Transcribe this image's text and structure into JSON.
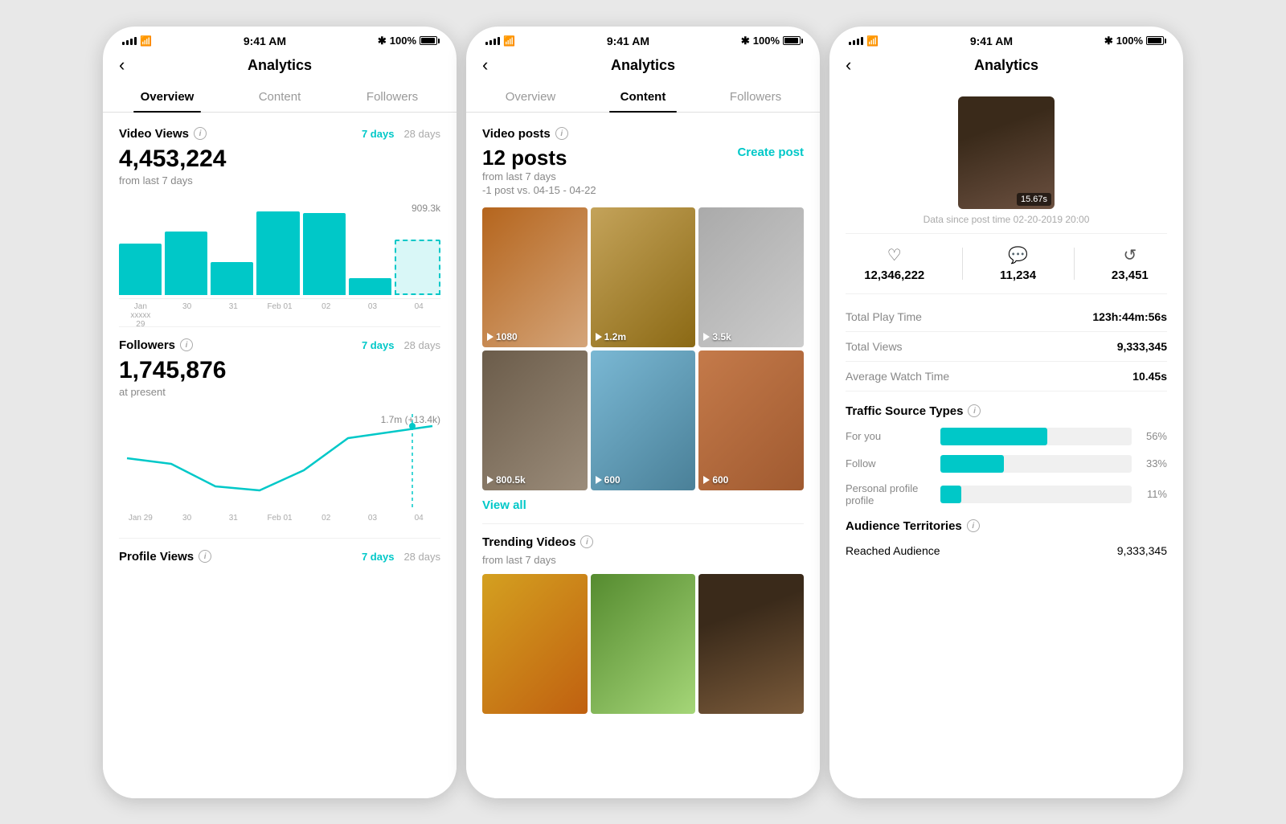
{
  "phones": [
    {
      "id": "overview",
      "statusBar": {
        "time": "9:41 AM",
        "battery": "100%"
      },
      "nav": {
        "back": "‹",
        "title": "Analytics"
      },
      "tabs": [
        {
          "label": "Overview",
          "active": true
        },
        {
          "label": "Content",
          "active": false
        },
        {
          "label": "Followers",
          "active": false
        }
      ],
      "videoViews": {
        "label": "Video Views",
        "period1": "7 days",
        "period2": "28 days",
        "value": "4,453,224",
        "sublabel": "from last 7 days",
        "chartTopLabel": "909.3k",
        "bars": [
          55,
          68,
          35,
          90,
          88,
          18,
          60
        ],
        "xLabels": [
          "Jan\nxxxxx\n29",
          "30",
          "31",
          "Feb 01",
          "02",
          "03",
          "04"
        ]
      },
      "followers": {
        "label": "Followers",
        "period1": "7 days",
        "period2": "28 days",
        "value": "1,745,876",
        "sublabel": "at present",
        "chartTopLabel": "1.7m (+13.4k)",
        "xLabels": [
          "Jan 29",
          "30",
          "31",
          "Feb 01",
          "02",
          "03",
          "04"
        ]
      },
      "profileViews": {
        "label": "Profile Views",
        "period1": "7 days",
        "period2": "28 days"
      }
    },
    {
      "id": "content",
      "statusBar": {
        "time": "9:41 AM",
        "battery": "100%"
      },
      "nav": {
        "back": "‹",
        "title": "Analytics"
      },
      "tabs": [
        {
          "label": "Overview",
          "active": false
        },
        {
          "label": "Content",
          "active": true
        },
        {
          "label": "Followers",
          "active": false
        }
      ],
      "videoPosts": {
        "label": "Video posts",
        "count": "12 posts",
        "sublabel": "from last 7 days",
        "change": "-1 post vs. 04-15 - 04-22",
        "createBtn": "Create post",
        "videos": [
          {
            "views": "1080",
            "color": "thumb-color-1"
          },
          {
            "views": "1.2m",
            "color": "thumb-color-2"
          },
          {
            "views": "3.5k",
            "color": "thumb-color-3"
          },
          {
            "views": "800.5k",
            "color": "thumb-color-4"
          },
          {
            "views": "600",
            "color": "thumb-color-5"
          },
          {
            "views": "600",
            "color": "thumb-color-6"
          }
        ],
        "viewAll": "View all"
      },
      "trendingVideos": {
        "label": "Trending Videos",
        "sublabel": "from last 7 days",
        "videos": [
          {
            "color": "thumb-food1"
          },
          {
            "color": "thumb-deer"
          },
          {
            "color": "thumb-arch"
          }
        ]
      }
    },
    {
      "id": "detail",
      "statusBar": {
        "time": "9:41 AM",
        "battery": "100%"
      },
      "nav": {
        "back": "‹",
        "title": "Analytics"
      },
      "postPreview": {
        "duration": "15.67s",
        "dataSince": "Data since post time 02-20-2019 20:00"
      },
      "metrics": {
        "likes": "12,346,222",
        "comments": "11,234",
        "shares": "23,451"
      },
      "stats": [
        {
          "label": "Total Play Time",
          "value": "123h:44m:56s"
        },
        {
          "label": "Total Views",
          "value": "9,333,345"
        },
        {
          "label": "Average Watch Time",
          "value": "10.45s"
        }
      ],
      "trafficSources": {
        "title": "Traffic Source Types",
        "items": [
          {
            "label": "For you",
            "pct": 56,
            "pctLabel": "56%"
          },
          {
            "label": "Follow",
            "pct": 33,
            "pctLabel": "33%"
          },
          {
            "label": "Personal profile profile",
            "pct": 11,
            "pctLabel": "11%"
          }
        ]
      },
      "audienceTerritories": {
        "title": "Audience Territories",
        "reachedLabel": "Reached Audience",
        "reachedValue": "9,333,345"
      }
    }
  ]
}
